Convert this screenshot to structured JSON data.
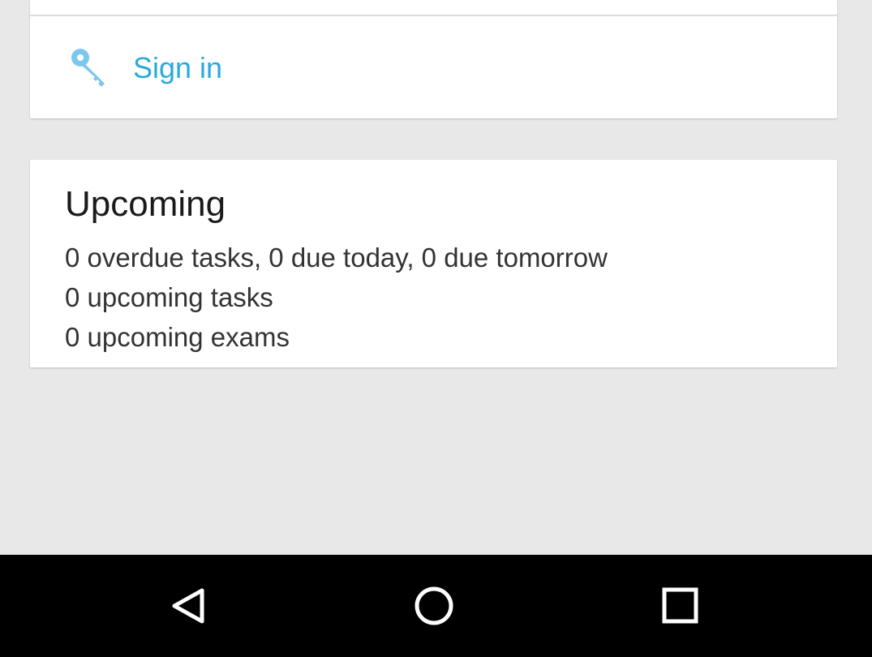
{
  "signin": {
    "label": "Sign in",
    "icon": "key-icon",
    "accent_color": "#29a9e0"
  },
  "upcoming": {
    "title": "Upcoming",
    "lines": [
      "0 overdue tasks, 0 due today, 0 due tomorrow",
      "0 upcoming tasks",
      "0 upcoming exams"
    ]
  },
  "navbar": {
    "buttons": [
      {
        "icon": "back-icon"
      },
      {
        "icon": "home-icon"
      },
      {
        "icon": "recents-icon"
      }
    ]
  },
  "colors": {
    "background": "#e8e8e8",
    "card": "#ffffff",
    "navbar": "#000000"
  }
}
